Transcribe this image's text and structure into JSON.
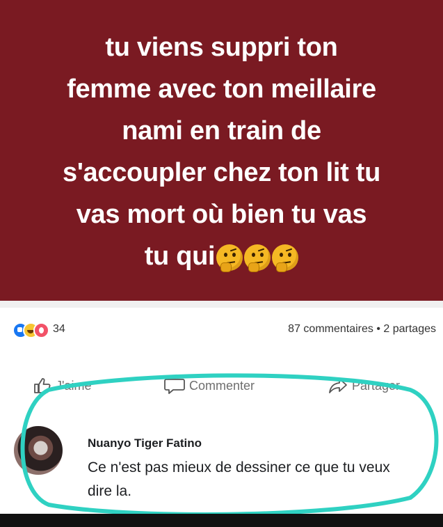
{
  "post": {
    "banner_lines": [
      "tu viens suppri ton",
      "femme avec ton meillaire",
      "nami en train de",
      "s'accoupler chez ton lit tu",
      "vas mort où bien tu vas",
      "tu qui"
    ],
    "banner_color": "#7a1a22",
    "emoji_icons": [
      "thinking-face-icon",
      "thinking-face-icon",
      "thinking-face-icon"
    ]
  },
  "reactions": {
    "icons": [
      "like-reaction-icon",
      "haha-reaction-icon",
      "love-reaction-icon"
    ],
    "count": "34",
    "stats": "87 commentaires • 2 partages"
  },
  "actions": {
    "like_label": "J'aime",
    "comment_label": "Commenter",
    "share_label": "Partager"
  },
  "comment": {
    "author": "Nuanyo Tiger Fatino",
    "text": "Ce n'est pas mieux de dessiner ce que tu veux dire la."
  },
  "colors": {
    "highlight_ring": "#2fd1c2",
    "like_blue": "#1877f2"
  }
}
